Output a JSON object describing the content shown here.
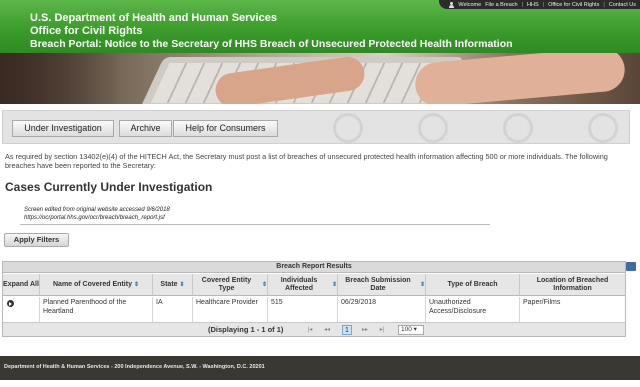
{
  "header": {
    "agency": "U.S. Department of Health and Human Services",
    "office": "Office for Civil Rights",
    "portal_title": "Breach Portal: Notice to the Secretary of HHS Breach of Unsecured Protected Health Information"
  },
  "topnav": {
    "welcome": "Welcome",
    "file_breach": "File a Breach",
    "hhs": "HHS",
    "ocr": "Office for Civil Rights",
    "contact": "Contact Us"
  },
  "tabs": [
    {
      "label": "Under Investigation"
    },
    {
      "label": "Archive"
    },
    {
      "label": "Help for Consumers"
    }
  ],
  "intro": "As required by section 13402(e)(4) of the HITECH Act, the Secretary must post a list of breaches of unsecured protected health information affecting 500 or more individuals. The following breaches have been reported to the Secretary:",
  "page_title": "Cases Currently Under Investigation",
  "note": {
    "line1": "Screen edited from original website accessed 9/6/2018",
    "line2": "https://ocrportal.hhs.gov/ocr/breach/breach_report.jsf"
  },
  "apply_filters": "Apply Filters",
  "grid": {
    "caption": "Breach Report Results",
    "sort_glyph": "⇕",
    "columns": [
      {
        "label": "Expand All"
      },
      {
        "label": "Name of Covered Entity"
      },
      {
        "label": "State"
      },
      {
        "label": "Covered Entity Type"
      },
      {
        "label": "Individuals Affected"
      },
      {
        "label": "Breach Submission Date"
      },
      {
        "label": "Type of Breach"
      },
      {
        "label": "Location of Breached Information"
      }
    ],
    "row": {
      "name": "Planned Parenthood of the Heartland",
      "state": "IA",
      "entity_type": "Healthcare Provider",
      "individuals": "515",
      "date": "06/29/2018",
      "breach_type": "Unauthorized Access/Disclosure",
      "location": "Paper/Films"
    },
    "pager": {
      "displaying": "(Displaying 1 - 1 of 1)",
      "first": "|◂",
      "prev": "◂◂",
      "current_page": "1",
      "next": "▸▸",
      "last": "▸|",
      "page_size": "100 ▾"
    }
  },
  "footer": "Department of Health & Human Services - 200 Independence Avenue, S.W. - Washington, D.C. 20201",
  "icons": {
    "expand": "expand-row-icon",
    "export": [
      "export-flag-icon",
      "pdf-icon",
      "excel-icon",
      "csv-icon"
    ],
    "person": "person-icon"
  }
}
